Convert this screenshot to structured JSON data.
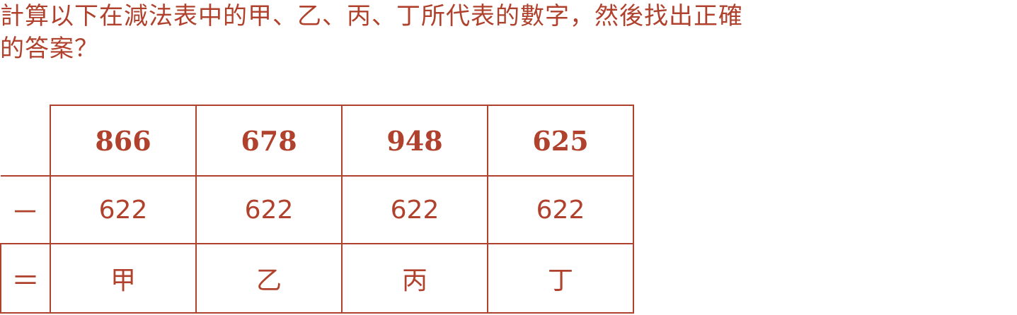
{
  "question": {
    "line1": "計算以下在減法表中的甲、乙、丙、丁所代表的數字，然後找出正確",
    "line2": "的答案？"
  },
  "table": {
    "minuends": [
      "866",
      "678",
      "948",
      "625"
    ],
    "operator_minus": "－",
    "subtrahends": [
      "622",
      "622",
      "622",
      "622"
    ],
    "operator_equals": "＝",
    "unknowns": [
      "甲",
      "乙",
      "丙",
      "丁"
    ]
  }
}
